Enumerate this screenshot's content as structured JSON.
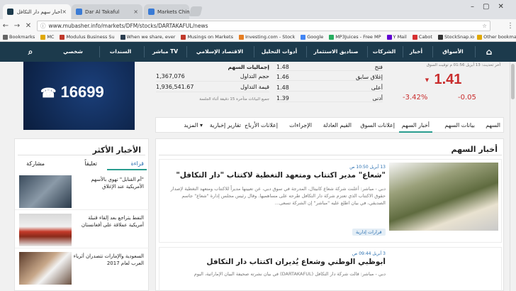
{
  "browser": {
    "tabs": [
      {
        "title": "أخبار سهم دار التكافل ش م ع - مباشر"
      },
      {
        "title": "Dar Al Takaful"
      },
      {
        "title": "Markets Chimp"
      }
    ],
    "url": "www.mubasher.info/markets/DFM/stocks/DARTAKAFUL/news",
    "bookmarks": [
      {
        "label": "Bookmarks",
        "color": "#666"
      },
      {
        "label": "MC",
        "color": "#e0a800"
      },
      {
        "label": "Modulus Business Su",
        "color": "#c0392b"
      },
      {
        "label": "When we share, ever",
        "color": "#2c3e50"
      },
      {
        "label": "Musings on Markets",
        "color": "#c0392b"
      },
      {
        "label": "Investing.com - Stock",
        "color": "#e67e22"
      },
      {
        "label": "Google",
        "color": "#4285f4"
      },
      {
        "label": "MP3Juices - Free MP",
        "color": "#27ae60"
      },
      {
        "label": "Y Mail",
        "color": "#6001d2"
      },
      {
        "label": "Cabot",
        "color": "#d63031"
      },
      {
        "label": "StockSnap.io",
        "color": "#333"
      },
      {
        "label": "Other bookmarks",
        "color": "#e0a800"
      }
    ]
  },
  "mainnav": {
    "items": [
      "الأسواق",
      "أخبار",
      "الشركات",
      "صناديق الاستثمار",
      "أدوات التحليل",
      "الاقتصاد الإسلامي",
      "مباشر TV",
      "السندات",
      "شخصي"
    ]
  },
  "ad": {
    "phone": "16699"
  },
  "totals": {
    "title": "إجماليات السهم",
    "rows": [
      {
        "label": "حجم التداول",
        "value": "1,367,076"
      },
      {
        "label": "قيمة التداول",
        "value": "1,936,541.67"
      }
    ],
    "note": "جميع البيانات متأخرة 15 دقيقة أثناء الجلسة"
  },
  "prices": {
    "rows": [
      {
        "label": "فتح",
        "value": "1.48"
      },
      {
        "label": "إغلاق سابق",
        "value": "1.46"
      },
      {
        "label": "أعلى",
        "value": "1.48"
      },
      {
        "label": "أدنى",
        "value": "1.39"
      }
    ]
  },
  "quote": {
    "updated": "آخر تحديث: 13 أبريل 01:56 م توقيت السوق",
    "price": "1.41",
    "change_pct": "-3.42%",
    "change": "-0.05"
  },
  "subtabs": [
    "السهم",
    "بيانات السهم",
    "أخبار السهم",
    "إعلانات السوق",
    "القيم العادلة",
    "الإجراءات",
    "إعلانات الأرباح",
    "تقارير إخبارية",
    "المزيد"
  ],
  "most": {
    "title": "الأخبار الأكثر",
    "tabs": [
      "قراءة",
      "تعليقاً",
      "مشاركة"
    ],
    "items": [
      {
        "text": "\"أم القنابل\" تهوي بالأسهم الأمريكية عند الإغلاق"
      },
      {
        "text": "النفط يتراجع بعد إلقاء قنبلة أمريكية عملاقة على أفغانستان"
      },
      {
        "text": "السعودية والإمارات تتصدران أثرياء العرب لعام 2017"
      }
    ]
  },
  "news": {
    "title": "أخبار السهم",
    "items": [
      {
        "date": "13 أبريل 10:50 ص",
        "headline": "\"شعاع\" مدير اكتتاب ومتعهد التغطية لاكتتاب \"دار التكافل\"",
        "summary": "دبي - مباشر: أعلنت شركة شعاع كابيتال، المدرجة في سوق دبي، عن تعيينها مديراً للاكتتاب ومتعهد التغطية لإصدار حقوق الاكتتاب الذي تعتزم شركة دار التكافل طرحه على مساهميها. وقال رئيس مجلس إدارة \"شعاع\" جاسم الصديقي، في بيان اطلع عليه \"مباشر\" إن الشركة تسعى...",
        "tag": "قرارات إدارية"
      },
      {
        "date": "3 أبريل 09:44 ص",
        "headline": "أبوظبي الوطني وشعاع يُديران اكتتاب دار التكافل",
        "summary": "دبي - مباشر: قالت شركة دار التكافل (DARTAKAFUL) في بيان نشرته صحيفة البيان الإماراتية، اليوم"
      }
    ]
  }
}
